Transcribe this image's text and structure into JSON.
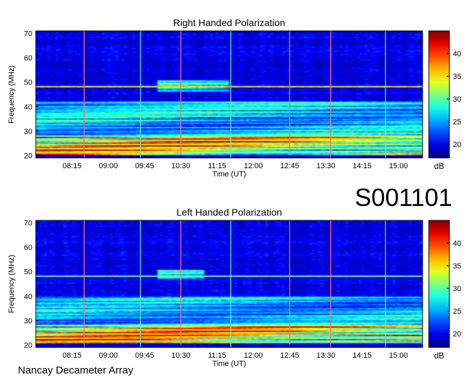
{
  "dataset_id": "S001101",
  "observatory": "Nancay Decameter Array",
  "colorbar": {
    "unit": "dB",
    "range": [
      17,
      45
    ],
    "ticks": [
      20,
      25,
      30,
      35,
      40
    ],
    "colormap": "jet"
  },
  "chart_data": [
    {
      "type": "heatmap",
      "title": "Right Handed Polarization",
      "xlabel": "Time (UT)",
      "ylabel": "Frequency (MHz)",
      "xlim": [
        "07:30",
        "15:30"
      ],
      "ylim": [
        19,
        71
      ],
      "x_ticks": [
        "08:15",
        "09:00",
        "09:45",
        "10:30",
        "11:15",
        "12:00",
        "12:45",
        "13:30",
        "14:15",
        "15:00"
      ],
      "y_ticks": [
        20,
        30,
        40,
        50,
        60,
        70
      ],
      "z_unit": "dB",
      "z_range": [
        17,
        45
      ],
      "features": [
        {
          "name": "strong interference band",
          "freq_mhz": [
            20,
            28
          ],
          "level_db": 42
        },
        {
          "name": "narrowband emission",
          "freq_mhz": 48.2,
          "level_db": 34
        },
        {
          "name": "enhanced broadband emission",
          "time_ut": [
            "10:00",
            "11:30"
          ],
          "freq_mhz": [
            46,
            51
          ],
          "level_db": 32
        },
        {
          "name": "broadband emission",
          "freq_mhz": [
            28,
            42
          ],
          "level_db": 29
        }
      ],
      "vertical_markers": [
        {
          "time_ut": "08:30",
          "color": "#ff7070"
        },
        {
          "time_ut": "09:40",
          "color": "#60e8c0"
        },
        {
          "time_ut": "10:30",
          "color": "#ff7070"
        },
        {
          "time_ut": "11:32",
          "color": "#60e8c0"
        },
        {
          "time_ut": "12:45",
          "color": "#ff7070"
        },
        {
          "time_ut": "13:36",
          "color": "#ff7070"
        },
        {
          "time_ut": "14:44",
          "color": "#60e8c0"
        }
      ]
    },
    {
      "type": "heatmap",
      "title": "Left Handed Polarization",
      "xlabel": "Time (UT)",
      "ylabel": "Frequency (MHz)",
      "xlim": [
        "07:30",
        "15:30"
      ],
      "ylim": [
        19,
        71
      ],
      "x_ticks": [
        "08:15",
        "09:00",
        "09:45",
        "10:30",
        "11:15",
        "12:00",
        "12:45",
        "13:30",
        "14:15",
        "15:00"
      ],
      "y_ticks": [
        20,
        30,
        40,
        50,
        60,
        70
      ],
      "z_unit": "dB",
      "z_range": [
        17,
        45
      ],
      "features": [
        {
          "name": "strong interference band",
          "freq_mhz": [
            21,
            28
          ],
          "level_db": 43
        },
        {
          "name": "narrowband emission",
          "freq_mhz": 48.2,
          "level_db": 30
        },
        {
          "name": "enhanced broadband emission",
          "time_ut": [
            "10:00",
            "11:00"
          ],
          "freq_mhz": [
            47,
            51
          ],
          "level_db": 31
        },
        {
          "name": "broadband emission",
          "freq_mhz": [
            28,
            40
          ],
          "level_db": 28
        }
      ],
      "vertical_markers": [
        {
          "time_ut": "08:30",
          "color": "#ff7070"
        },
        {
          "time_ut": "09:40",
          "color": "#60e8c0"
        },
        {
          "time_ut": "10:30",
          "color": "#ff7070"
        },
        {
          "time_ut": "11:32",
          "color": "#60e8c0"
        },
        {
          "time_ut": "12:45",
          "color": "#ff7070"
        },
        {
          "time_ut": "13:36",
          "color": "#ff7070"
        },
        {
          "time_ut": "14:44",
          "color": "#60e8c0"
        }
      ]
    }
  ]
}
